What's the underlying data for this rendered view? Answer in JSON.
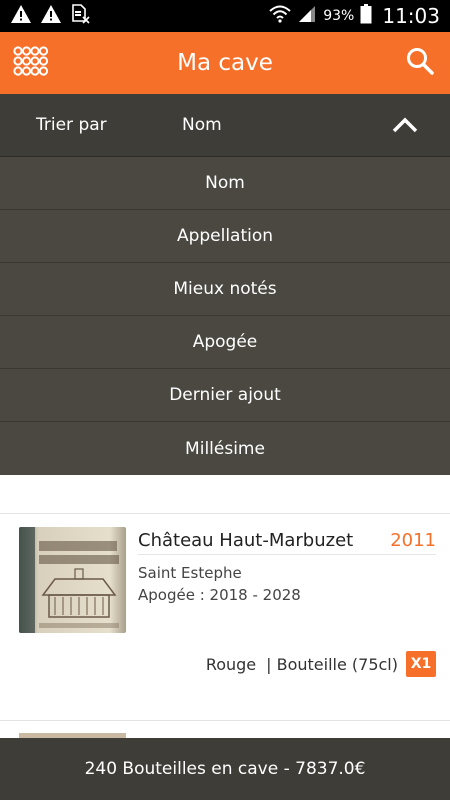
{
  "status_bar": {
    "battery": "93%",
    "time": "11:03",
    "icons": [
      "warning-icon",
      "warning-icon",
      "sim-card-x-icon",
      "wifi-icon",
      "signal-icon",
      "battery-icon"
    ]
  },
  "app_bar": {
    "title": "Ma cave",
    "left_icon": "bottle-grid-icon",
    "right_icon": "search-icon"
  },
  "sort": {
    "label": "Trier par",
    "selected": "Nom",
    "options": [
      "Nom",
      "Appellation",
      "Mieux notés",
      "Apogée",
      "Dernier ajout",
      "Millésime"
    ]
  },
  "wines": [
    {
      "name": "Château Haut-Marbuzet",
      "year": "2011",
      "appellation": "Saint Estephe",
      "apogee": "Apogée : 2018 - 2028",
      "color": "Rouge",
      "format": "| Bouteille (75cl)",
      "quantity": "X1"
    }
  ],
  "footer": {
    "summary": "240 Bouteilles en cave - 7837.0€"
  },
  "colors": {
    "accent": "#f7702a",
    "dark_bar": "#3f3d37",
    "menu_bg": "#4a4841"
  }
}
